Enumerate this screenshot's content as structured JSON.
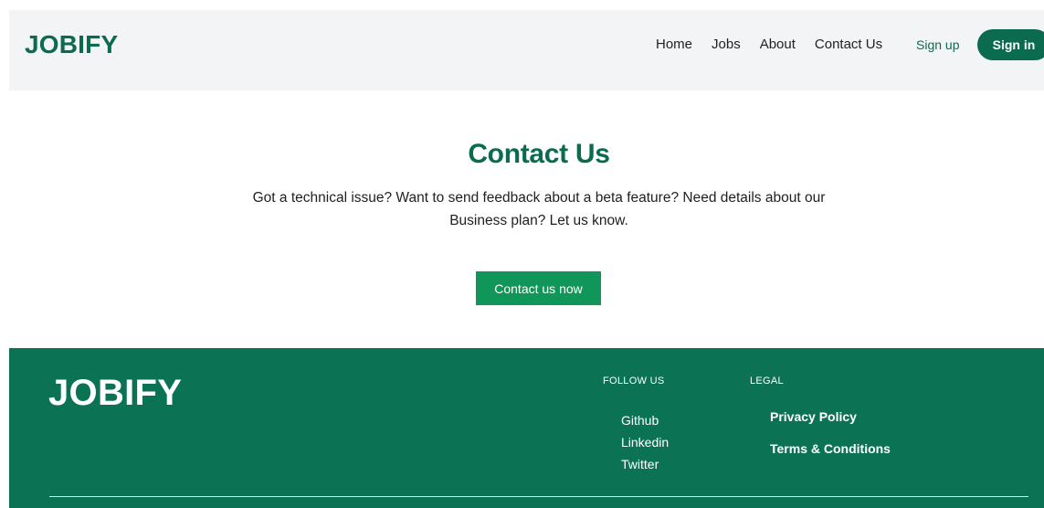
{
  "header": {
    "logo": "JOBIFY",
    "nav": [
      "Home",
      "Jobs",
      "About",
      "Contact Us"
    ],
    "signup_label": "Sign up",
    "signin_label": "Sign in"
  },
  "hero": {
    "title": "Contact Us",
    "description": "Got a technical issue? Want to send feedback about a beta feature? Need details about our Business plan? Let us know.",
    "cta_label": "Contact us now"
  },
  "footer": {
    "logo": "JOBIFY",
    "follow_heading": "FOLLOW US",
    "follow_links": [
      "Github",
      "Linkedin",
      "Twitter"
    ],
    "legal_heading": "LEGAL",
    "legal_links": [
      "Privacy Policy",
      "Terms & Conditions"
    ]
  },
  "colors": {
    "brand": "#0b6b4e",
    "cta": "#11965a",
    "footer_bg": "#0b7354",
    "header_bg": "#f3f4f6"
  }
}
